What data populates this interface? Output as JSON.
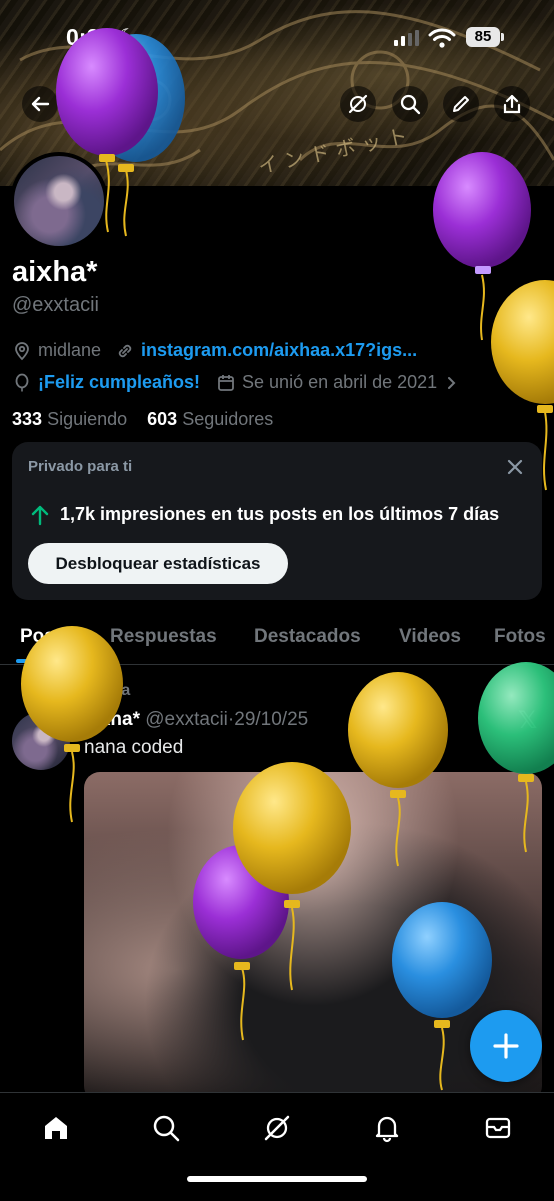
{
  "status_bar": {
    "time": "0:21",
    "battery": "85"
  },
  "profile": {
    "display_name": "aixha*",
    "username": "@exxtacii",
    "location": "midlane",
    "link": "instagram.com/aixhaa.x17?igs...",
    "birthday": "¡Feliz cumpleaños!",
    "joined": "Se unió en abril de 2021",
    "following_count": "333",
    "following_label": "Siguiendo",
    "followers_count": "603",
    "followers_label": "Seguidores"
  },
  "private_card": {
    "title": "Privado para ti",
    "impressions_text": "1,7k impresiones en tus posts en los últimos 7 días",
    "unlock_button": "Desbloquear estadísticas"
  },
  "tabs": [
    {
      "label": "Posts",
      "active": true
    },
    {
      "label": "Respuestas",
      "active": false
    },
    {
      "label": "Destacados",
      "active": false
    },
    {
      "label": "Videos",
      "active": false
    },
    {
      "label": "Fotos",
      "active": false
    }
  ],
  "pinned_post": {
    "pinned_label": "Fijada",
    "author_name": "aixha*",
    "author_handle": "@exxtacii",
    "separator": "·",
    "date": "29/10/25",
    "text": "nana coded"
  },
  "icons": {
    "top_bar": [
      "back-arrow-icon",
      "grok-icon",
      "search-icon",
      "edit-icon",
      "share-icon"
    ],
    "bottom_nav": [
      "home-icon",
      "search-icon",
      "grok-icon",
      "notifications-icon",
      "messages-icon"
    ],
    "fab": "plus-icon"
  },
  "colors": {
    "accent": "#1d9bf0",
    "balloon_purple": "#9b2fd6",
    "balloon_blue": "#2a8fe0",
    "balloon_yellow": "#e6b81e",
    "balloon_green": "#2ec980",
    "up_arrow": "#00ba7c"
  }
}
